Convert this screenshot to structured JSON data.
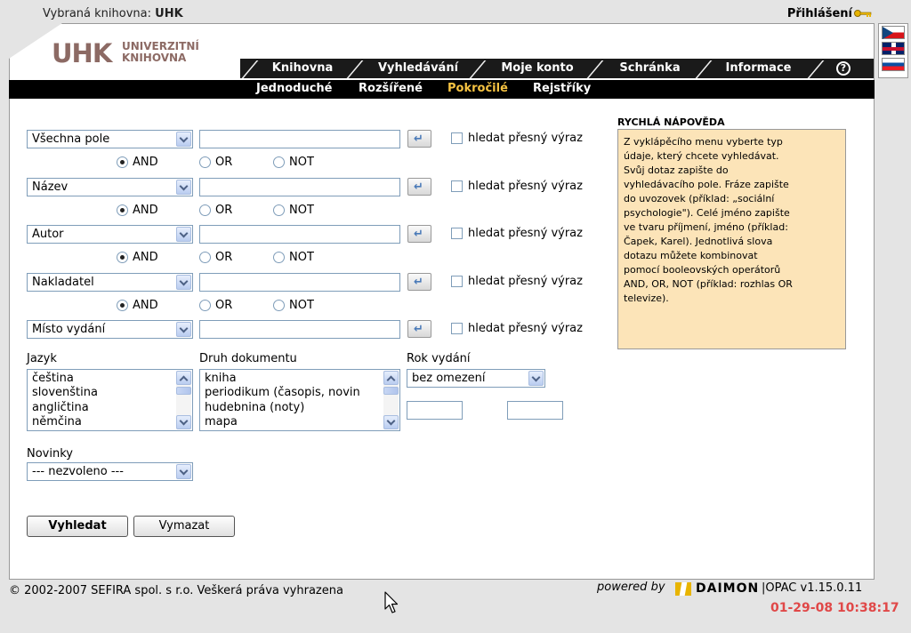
{
  "top": {
    "library_label": "Vybraná knihovna:",
    "library_name": "UHK",
    "login": "Přihlášení",
    "key_icon": "key-icon"
  },
  "logo": {
    "abbr": "UHK",
    "line1": "UNIVERZITNÍ",
    "line2": "KNIHOVNA"
  },
  "main_nav": {
    "tabs": [
      "Knihovna",
      "Vyhledávání",
      "Moje konto",
      "Schránka",
      "Informace"
    ],
    "active": "Vyhledávání",
    "help_icon": "help-icon"
  },
  "sub_nav": {
    "items": [
      "Jednoduché",
      "Rozšířené",
      "Pokročilé",
      "Rejstříky"
    ],
    "active": "Pokročilé",
    "active_color": "#f6c342"
  },
  "search": {
    "rows": [
      {
        "field": "Všechna pole",
        "value": "",
        "exact_label": "hledat přesný výraz"
      },
      {
        "field": "Název",
        "value": "",
        "exact_label": "hledat přesný výraz"
      },
      {
        "field": "Autor",
        "value": "",
        "exact_label": "hledat přesný výraz"
      },
      {
        "field": "Nakladatel",
        "value": "",
        "exact_label": "hledat přesný výraz"
      },
      {
        "field": "Místo vydání",
        "value": "",
        "exact_label": "hledat přesný výraz"
      }
    ],
    "operators": [
      "AND",
      "OR",
      "NOT"
    ],
    "selected_operator": "AND"
  },
  "filters": {
    "language_label": "Jazyk",
    "languages": [
      "čeština",
      "slovenština",
      "angličtina",
      "němčina"
    ],
    "doctype_label": "Druh dokumentu",
    "doctypes": [
      "kniha",
      "periodikum (časopis, novin",
      "hudebnina (noty)",
      "mapa"
    ],
    "year_label": "Rok vydání",
    "year_value": "bez omezení",
    "year_from": "",
    "year_to": "",
    "new_label": "Novinky",
    "new_value": "--- nezvoleno ---"
  },
  "buttons": {
    "search": "Vyhledat",
    "clear": "Vymazat"
  },
  "help": {
    "title": "RYCHLÁ NÁPOVĚDA",
    "lines": [
      "Z vyklápěcího menu vyberte typ",
      "údaje, který chcete vyhledávat.",
      "Svůj dotaz zapište do",
      "vyhledávacího pole. Fráze zapište",
      "do uvozovek (příklad: „sociální",
      "psychologie\"). Celé jméno zapište",
      "ve tvaru příjmení, jméno (příklad:",
      "Čapek, Karel). Jednotlivá slova",
      "dotazu můžete kombinovat",
      "pomocí booleovských operátorů",
      "AND, OR, NOT (příklad: rozhlas OR",
      "televize)."
    ]
  },
  "footer": {
    "copyright": "© 2002-2007 SEFIRA spol. s r.o. Veškerá práva vyhrazena",
    "powered_by": "powered by",
    "daimon": "DAIMON",
    "opac": "|OPAC v1.15.0.11",
    "clock": "01-29-08 10:38:17"
  },
  "flags": [
    "czech-flag-icon",
    "uk-flag-icon",
    "slovak-flag-icon"
  ]
}
